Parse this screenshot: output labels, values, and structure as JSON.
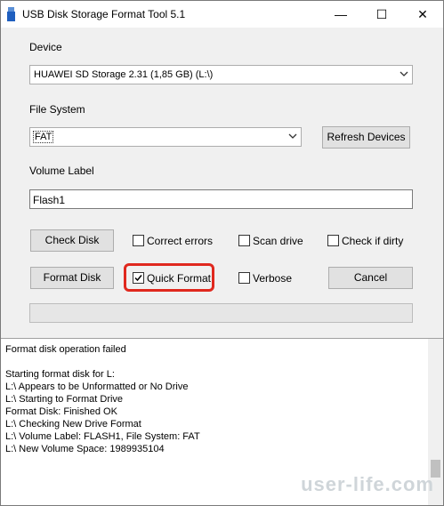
{
  "window": {
    "title": "USB Disk Storage Format Tool 5.1",
    "minimize_glyph": "—",
    "maximize_glyph": "☐",
    "close_glyph": "✕"
  },
  "device": {
    "label": "Device",
    "selected": "HUAWEI  SD Storage  2.31 (1,85 GB) (L:\\)"
  },
  "file_system": {
    "label": "File System",
    "selected": "FAT",
    "refresh_button": "Refresh Devices"
  },
  "volume_label": {
    "label": "Volume Label",
    "value": "Flash1"
  },
  "buttons": {
    "check_disk": "Check Disk",
    "format_disk": "Format Disk",
    "cancel": "Cancel"
  },
  "options": {
    "correct_errors": {
      "label": "Correct errors",
      "checked": false
    },
    "scan_drive": {
      "label": "Scan drive",
      "checked": false
    },
    "check_if_dirty": {
      "label": "Check if dirty",
      "checked": false
    },
    "quick_format": {
      "label": "Quick Format",
      "checked": true
    },
    "verbose": {
      "label": "Verbose",
      "checked": false
    }
  },
  "progress": {
    "value": 0
  },
  "log": {
    "lines": [
      "Format disk operation failed",
      "",
      "Starting format disk for L:",
      "L:\\ Appears to be Unformatted or No Drive",
      "L:\\ Starting to Format Drive",
      "Format Disk: Finished OK",
      "L:\\ Checking New Drive Format",
      "L:\\ Volume Label: FLASH1, File System: FAT",
      "L:\\ New Volume Space: 1989935104"
    ]
  },
  "watermark": "user-life.com",
  "colors": {
    "highlight": "#e0281e",
    "dialog_bg": "#f0f0f0",
    "watermark": "#cfd5d9"
  },
  "icons": [
    "usb-app-icon",
    "minimize-icon",
    "maximize-icon",
    "close-icon",
    "chevron-down-icon",
    "checkmark-icon"
  ]
}
